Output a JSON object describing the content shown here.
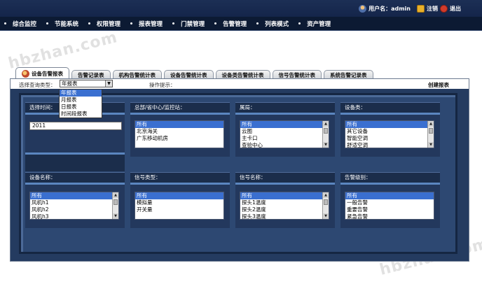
{
  "header": {
    "username_label": "用户名：admin",
    "logout_label": "注销",
    "exit_label": "退出"
  },
  "nav": {
    "items": [
      "综合监控",
      "节能系统",
      "权限管理",
      "报表管理",
      "门禁管理",
      "告警管理",
      "列表模式",
      "资产管理"
    ]
  },
  "watermark": "hbzhan.com",
  "tabs": [
    "设备告警报表",
    "告警记录表",
    "机构告警统计表",
    "设备告警统计表",
    "设备类告警统计表",
    "信号告警统计表",
    "系统告警记录表"
  ],
  "toolbar": {
    "query_type_label": "选择查询类型：",
    "query_type_value": "年报表",
    "query_type_options": [
      "年报表",
      "月报表",
      "日报表",
      "时间段报表"
    ],
    "hint_label": "操作提示：",
    "create_label": "创建报表"
  },
  "filters": {
    "time": {
      "title": "选择时间：",
      "value": "2011"
    },
    "org": {
      "title": "总部/省中心/监控站：",
      "options": [
        "所有",
        "北京海关",
        "广东移动机房"
      ]
    },
    "room": {
      "title": "属局：",
      "options": [
        "所有",
        "云图",
        "主卡口",
        "查验中心"
      ]
    },
    "device_type": {
      "title": "设备类：",
      "options": [
        "所有",
        "其它设备",
        "智能空调",
        "舒适空调"
      ]
    },
    "device_name": {
      "title": "设备名称：",
      "options": [
        "所有",
        "风机h1",
        "风机h2",
        "风机h3"
      ]
    },
    "signal_type": {
      "title": "信号类型：",
      "options": [
        "所有",
        "模拟量",
        "开关量"
      ]
    },
    "signal_name": {
      "title": "信号名称：",
      "options": [
        "所有",
        "探头1温度",
        "探头2温度",
        "探头3温度"
      ]
    },
    "alarm_level": {
      "title": "告警级别：",
      "options": [
        "所有",
        "一般告警",
        "重要告警",
        "紧急告警"
      ]
    }
  }
}
